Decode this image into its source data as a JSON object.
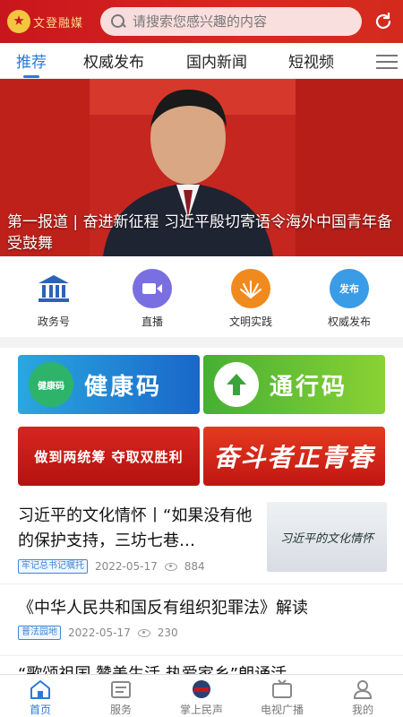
{
  "header": {
    "logo_text": "文登融媒",
    "search_placeholder": "请搜索您感兴趣的内容"
  },
  "tabs": [
    {
      "label": "推荐",
      "active": true
    },
    {
      "label": "权威发布",
      "active": false
    },
    {
      "label": "国内新闻",
      "active": false
    },
    {
      "label": "短视频",
      "active": false
    }
  ],
  "banner": {
    "caption": "第一报道 | 奋进新征程 习近平殷切寄语令海外中国青年备受鼓舞"
  },
  "quick_links": [
    {
      "label": "政务号",
      "icon": "building-icon",
      "color": "#2c62b8"
    },
    {
      "label": "直播",
      "icon": "video-icon",
      "color": "#7a6fe0"
    },
    {
      "label": "文明实践",
      "icon": "sunburst-icon",
      "color": "#f08a1e"
    },
    {
      "label": "权威发布",
      "icon": "publish-icon",
      "color": "#3a9be6",
      "icon_text": "发布"
    }
  ],
  "tiles": {
    "health": {
      "label": "健康码",
      "badge": "健康码"
    },
    "pass": {
      "label": "通行码"
    },
    "banner1": {
      "label": "做到两统筹 夺取双胜利"
    },
    "banner2": {
      "label": "奋斗者正青春"
    }
  },
  "news": [
    {
      "title": "习近平的文化情怀丨“如果没有他的保护支持，三坊七巷…",
      "tag": "牢记总书记嘱托",
      "date": "2022-05-17",
      "views": "884",
      "thumb_text": "习近平的文化情怀"
    },
    {
      "title": "《中华人民共和国反有组织犯罪法》解读",
      "tag": "普法园地",
      "date": "2022-05-17",
      "views": "230"
    },
    {
      "title": "“歌颂祖国 赞美生活 热爱家乡”朗诵活"
    }
  ],
  "bottom_nav": [
    {
      "label": "首页",
      "icon": "home-icon",
      "active": true
    },
    {
      "label": "服务",
      "icon": "service-icon",
      "active": false
    },
    {
      "label": "掌上民声",
      "icon": "voice-icon",
      "active": false
    },
    {
      "label": "电视广播",
      "icon": "tv-icon",
      "active": false
    },
    {
      "label": "我的",
      "icon": "user-icon",
      "active": false
    }
  ],
  "colors": {
    "brand_red": "#c8161d",
    "accent_blue": "#2a7ad8"
  }
}
